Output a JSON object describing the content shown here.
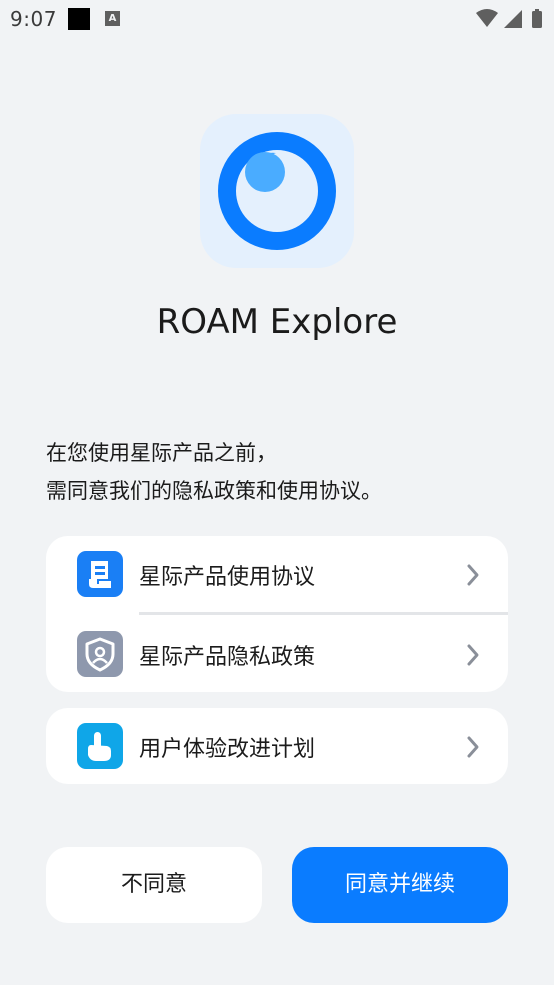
{
  "status_bar": {
    "time": "9:07",
    "notification_glyph": "A",
    "icons": [
      "black-square-icon",
      "a-notification-icon",
      "wifi-icon",
      "signal-icon",
      "battery-icon"
    ]
  },
  "app": {
    "name": "ROAM Explore",
    "icon": "app-logo-icon"
  },
  "consent": {
    "line1": "在您使用星际产品之前，",
    "line2": "需同意我们的隐私政策和使用协议。"
  },
  "items": [
    {
      "label": "星际产品使用协议",
      "icon": "agreement-doc-icon",
      "icon_color": "#1a7ff5"
    },
    {
      "label": "星际产品隐私政策",
      "icon": "privacy-shield-icon",
      "icon_color": "#8e98ad"
    },
    {
      "label": "用户体验改进计划",
      "icon": "hand-pointer-icon",
      "icon_color": "#0fa6e8"
    }
  ],
  "buttons": {
    "disagree": "不同意",
    "agree": "同意并继续"
  },
  "colors": {
    "background": "#f1f3f5",
    "accent": "#0a7cff",
    "card": "#ffffff"
  }
}
